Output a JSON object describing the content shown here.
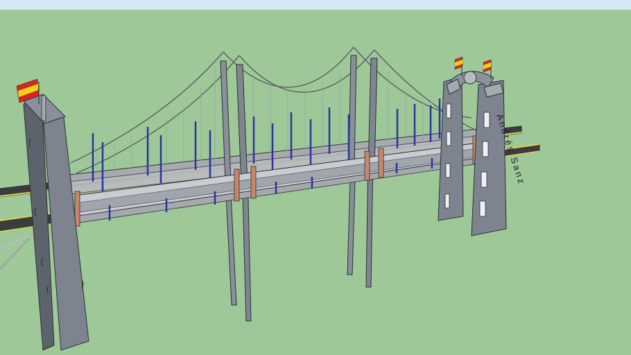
{
  "model": {
    "tower_inscription": "Andrés Sanz"
  },
  "colors": {
    "ground": "#9ec897",
    "sky": "#d6e8f4",
    "concrete": "#7d848f",
    "concrete_dark": "#5d636c",
    "deck": "#3a3c40",
    "edge_line": "#e3d34a",
    "railing": "#b9bcc0",
    "lamp_post": "#2a34a0",
    "beam": "#c8866a",
    "flag_red": "#d5261f",
    "flag_yellow": "#f4d21a"
  }
}
